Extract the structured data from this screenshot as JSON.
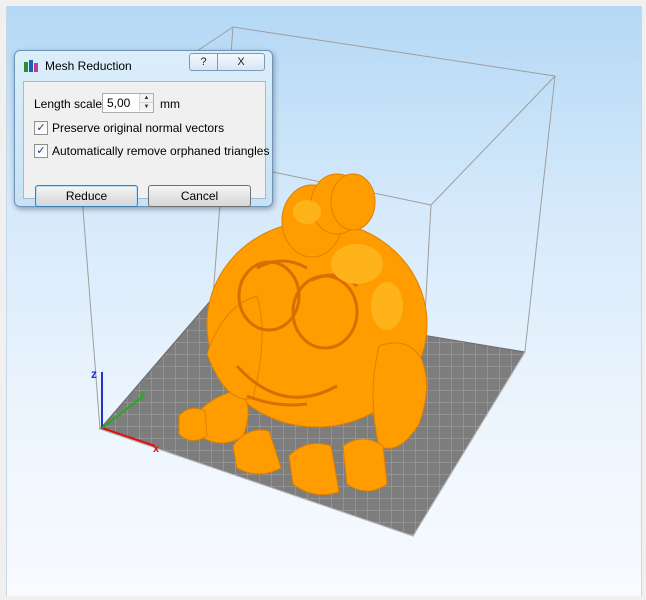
{
  "dialog": {
    "title": "Mesh Reduction",
    "help_label": "?",
    "close_label": "X",
    "length_scale_label": "Length scale",
    "length_scale_value": "5,00",
    "unit": "mm",
    "preserve_normals": {
      "label": "Preserve original normal vectors",
      "checked": true
    },
    "remove_orphans": {
      "label": "Automatically remove orphaned triangles",
      "checked": true
    },
    "reduce_label": "Reduce",
    "cancel_label": "Cancel"
  },
  "viewport": {
    "axis_labels": {
      "x": "x",
      "y": "y",
      "z": "z"
    },
    "model_color": "#ff9c00",
    "grid_color": "#8a8a8a"
  },
  "icons": {
    "app": "app-logo-icon",
    "check": "✓",
    "spin_up": "▲",
    "spin_down": "▼"
  }
}
